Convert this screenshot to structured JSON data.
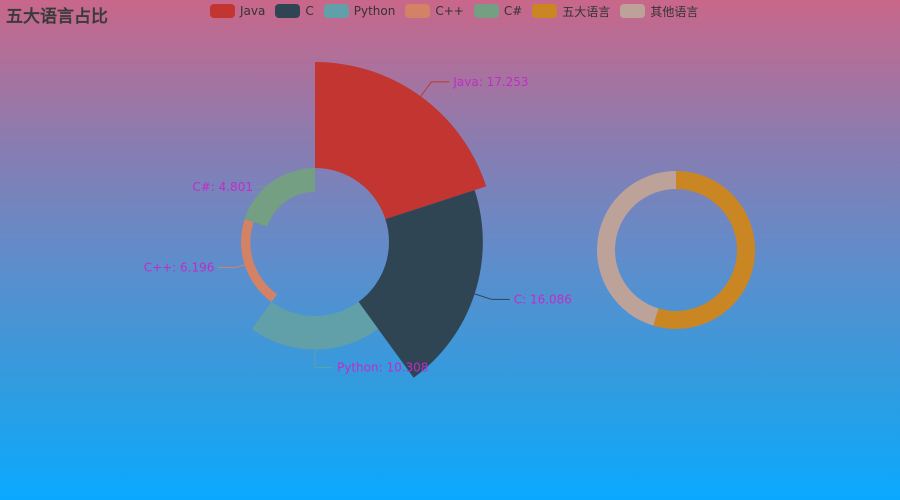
{
  "chart_data": [
    {
      "type": "pie",
      "variant": "rose",
      "title": "五大语言占比",
      "legend": [
        "Java",
        "C",
        "Python",
        "C++",
        "C#",
        "五大语言",
        "其他语言"
      ],
      "series": [
        {
          "name": "Java",
          "value": 17.253,
          "color": "#c23531"
        },
        {
          "name": "C",
          "value": 16.086,
          "color": "#2f4554"
        },
        {
          "name": "Python",
          "value": 10.308,
          "color": "#61a0a8"
        },
        {
          "name": "C++",
          "value": 6.196,
          "color": "#d48265"
        },
        {
          "name": "C#",
          "value": 4.801,
          "color": "#749f83"
        }
      ]
    },
    {
      "type": "pie",
      "variant": "donut",
      "series": [
        {
          "name": "五大语言",
          "value": 54.644,
          "color": "#ca8622"
        },
        {
          "name": "其他语言",
          "value": 45.356,
          "color": "#bda29a"
        }
      ]
    }
  ]
}
